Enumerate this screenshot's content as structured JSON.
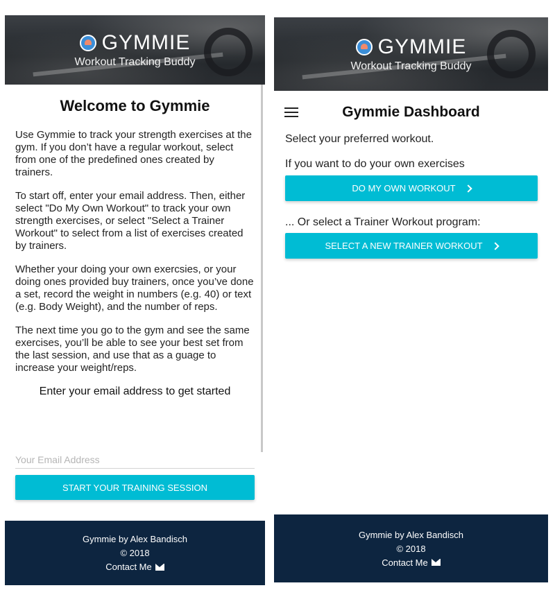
{
  "brand": {
    "title": "GYMMIE",
    "subtitle": "Workout Tracking Buddy"
  },
  "welcome_screen": {
    "heading": "Welcome to Gymmie",
    "paragraphs": [
      "Use Gymmie to track your strength exercises at the gym. If you don’t have a regular workout, select from one of the predefined ones created by trainers.",
      "To start off, enter your email address. Then, either select \"Do My Own Workout\" to track your own strength exercises, or select \"Select a Trainer Workout\" to select from a list of exercises created by trainers.",
      "Whether your doing your own exercsies, or your doing ones provided buy trainers, once you’ve done a set, record the weight in numbers (e.g. 40) or text (e.g. Body Weight), and the number of reps.",
      "The next time you go to the gym and see the same exercises, you’ll be able to see your best set from the last session, and use that as a guage to increase your weight/reps."
    ],
    "email_prompt": "Enter your email address to get started",
    "email_placeholder": "Your Email Address",
    "email_value": "",
    "start_button": "START YOUR TRAINING SESSION"
  },
  "dashboard": {
    "title": "Gymmie Dashboard",
    "select_text": "Select your preferred workout.",
    "own_text": "If you want to do your own exercises",
    "own_button": "DO MY OWN WORKOUT",
    "trainer_text": "... Or select a Trainer Workout program:",
    "trainer_button": "SELECT A NEW TRAINER WORKOUT"
  },
  "footer": {
    "credit": "Gymmie by Alex Bandisch",
    "copyright": "© 2018",
    "contact": "Contact Me"
  },
  "colors": {
    "accent": "#00bcd4",
    "footer_bg": "#0d2540"
  },
  "icons": [
    "dumbbell-logo-icon",
    "menu-icon",
    "chevron-right-icon",
    "envelope-icon"
  ]
}
